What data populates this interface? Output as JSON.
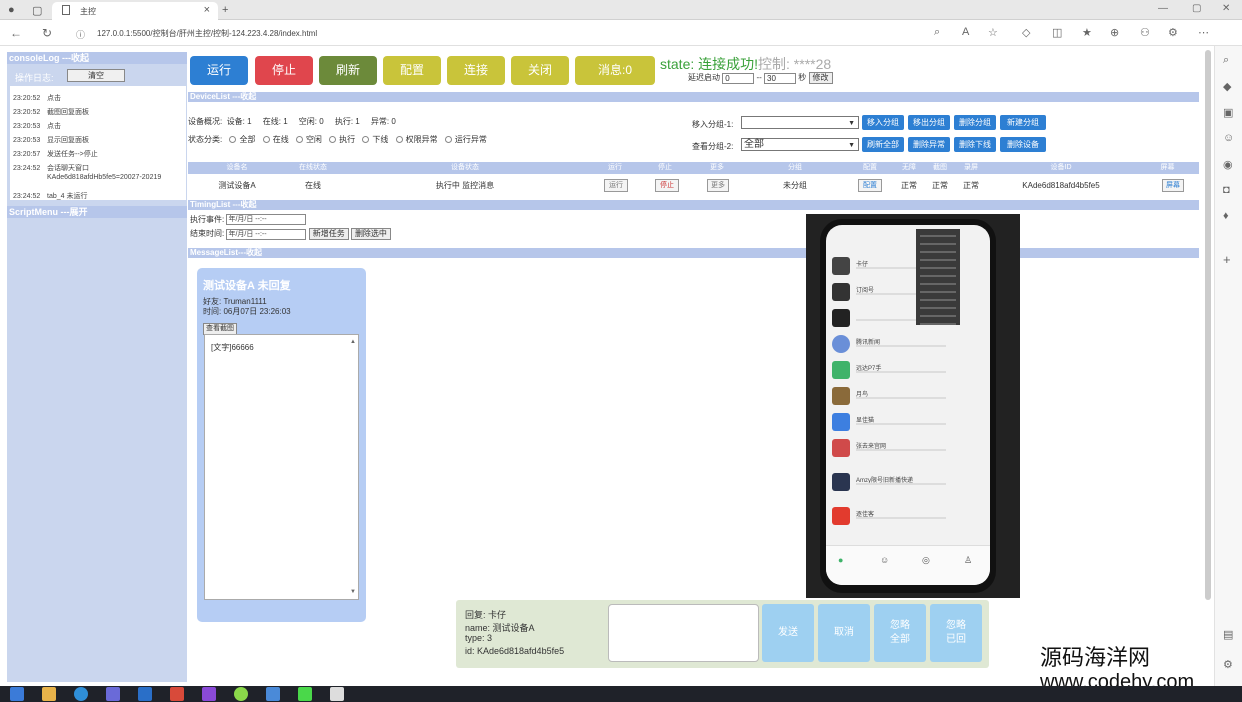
{
  "browser": {
    "tab_title": "主控",
    "url": "127.0.0.1:5500/控制台/肝州主控/控制-124.223.4.28/index.html"
  },
  "console_log": {
    "header": "consoleLog ---收起",
    "op_label": "操作日志:",
    "clear_label": "清空",
    "rows": [
      {
        "time": "23:20:52",
        "text": "点击"
      },
      {
        "time": "23:20:52",
        "text": "截图回复面板"
      },
      {
        "time": "23:20:53",
        "text": "点击"
      },
      {
        "time": "23:20:53",
        "text": "显示回复面板"
      },
      {
        "time": "23:20:57",
        "text": "发送任务-->停止"
      },
      {
        "time": "23:24:52",
        "text": "会话聊天窗口",
        "sub": "KAde6d818afdHb5fe5=20027-20219"
      },
      {
        "time": "23:24:52",
        "text": "tab_4 未运行"
      }
    ]
  },
  "script_menu": {
    "header": "ScriptMenu ---展开"
  },
  "toolbar": {
    "run": "运行",
    "stop": "停止",
    "refresh": "刷新",
    "config": "配置",
    "connect": "连接",
    "close": "关闭",
    "messages": "消息:0"
  },
  "state": {
    "label": "state:",
    "value": "连接成功!",
    "extra": "控制: ****28",
    "restart_label": "延迟启动",
    "from_value": "0",
    "sep": "--",
    "to_value": "30",
    "unit": "秒",
    "modify_label": "修改"
  },
  "device_list": {
    "header": "DeviceList ---收起",
    "overview_label": "设备概况:",
    "overview": [
      {
        "label": "设备:",
        "value": "1"
      },
      {
        "label": "在线:",
        "value": "1"
      },
      {
        "label": "空闲:",
        "value": "0"
      },
      {
        "label": "执行:",
        "value": "1"
      },
      {
        "label": "异常:",
        "value": "0"
      }
    ],
    "status_label": "状态分类:",
    "status_options": [
      "全部",
      "在线",
      "空闲",
      "执行",
      "下线",
      "权限异常",
      "运行异常"
    ],
    "move_group_label": "移入分组-1:",
    "view_group_label": "查看分组-2:",
    "view_group_value": "全部",
    "row1_buttons": [
      "移入分组",
      "移出分组",
      "删除分组",
      "新建分组"
    ],
    "row2_buttons": [
      "刷新全部",
      "删除异常",
      "删除下线",
      "删除设备"
    ],
    "columns": [
      "设备名",
      "在线状态",
      "设备状态",
      "运行",
      "停止",
      "更多",
      "分组",
      "配置",
      "无障",
      "截图",
      "录屏",
      "设备ID",
      "屏幕"
    ],
    "rows": [
      {
        "name": "测试设备A",
        "online": "在线",
        "status": "执行中 监控消息",
        "run": "运行",
        "stop": "停止",
        "more": "更多",
        "group": "未分组",
        "config": "配置",
        "a11y": "正常",
        "capture": "正常",
        "record": "正常",
        "id": "KAde6d818afd4b5fe5",
        "screen": "屏幕"
      }
    ]
  },
  "timing_list": {
    "header": "TimingList ---收起",
    "exec_label": "执行事件:",
    "end_label": "结束时间:",
    "datetime_placeholder": "年/月/日 --:-- ",
    "new_task": "新增任务",
    "delete_selected": "删除选中"
  },
  "message_list": {
    "header": "MessageList---收起",
    "card": {
      "title": "测试设备A 未回复",
      "friend": "好友: Truman1111",
      "time": "时间: 06月07日 23:26:03",
      "view_shot": "查看截图",
      "message": "[文字]66666"
    }
  },
  "phone": {
    "apps": [
      "卡仔",
      "订阅号",
      "",
      "腾讯新闻",
      "远达P7手",
      "月鸟",
      "显佳猫",
      "张去来宫网",
      "Amzy限号旧新播快递",
      "逐佳客"
    ]
  },
  "reply": {
    "reply_to": "回复: 卡仔",
    "name": "name: 测试设备A",
    "type": "type: 3",
    "id": "id: KAde6d818afd4b5fe5",
    "send": "发送",
    "cancel": "取消",
    "ignore_all": "忽略\n全部",
    "ignore_read": "忽略\n已回"
  },
  "watermark": {
    "cn": "源码海洋网",
    "url": "www.codehy.com"
  },
  "colors": {
    "run": "#2d7fd3",
    "stop": "#e0464d",
    "refresh": "#6c8a3a",
    "yellow": "#c9c43a",
    "section": "#b6c6ea",
    "state_green": "#3aa13a"
  }
}
